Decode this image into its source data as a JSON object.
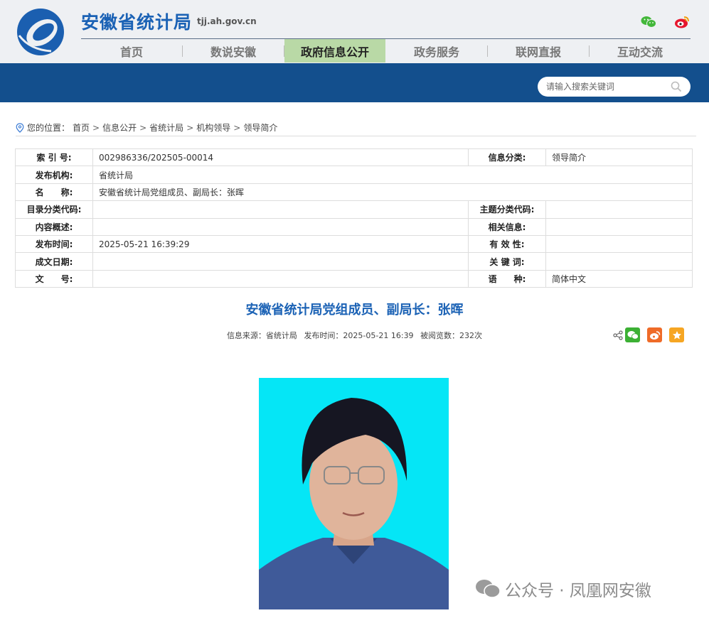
{
  "header": {
    "site_title": "安徽省统计局",
    "site_domain": "tjj.ah.gov.cn",
    "nav": [
      "首页",
      "数说安徽",
      "政府信息公开",
      "政务服务",
      "联网直报",
      "互动交流"
    ],
    "active_nav": "政府信息公开",
    "search_placeholder": "请输入搜索关键词"
  },
  "breadcrumb": {
    "prefix": "您的位置：",
    "items": [
      "首页",
      "信息公开",
      "省统计局",
      "机构领导",
      "领导简介"
    ]
  },
  "meta_table": {
    "index_label": "索 引 号:",
    "index_value": "002986336/202505-00014",
    "category_label": "信息分类:",
    "category_value": "领导简介",
    "publisher_label": "发布机构:",
    "publisher_value": "省统计局",
    "name_label": "名　　称:",
    "name_value": "安徽省统计局党组成员、副局长：张晖",
    "catalog_label": "目录分类代码:",
    "catalog_value": "",
    "topic_label": "主题分类代码:",
    "topic_value": "",
    "summary_label": "内容概述:",
    "summary_value": "",
    "related_label": "相关信息:",
    "related_value": "",
    "pubtime_label": "发布时间:",
    "pubtime_value": "2025-05-21 16:39:29",
    "validity_label": "有 效 性:",
    "validity_value": "",
    "date_label": "成文日期:",
    "date_value": "",
    "keyword_label": "关 键 词:",
    "keyword_value": "",
    "docno_label": "文　　号:",
    "docno_value": "",
    "language_label": "语　　种:",
    "language_value": "简体中文"
  },
  "article": {
    "title": "安徽省统计局党组成员、副局长：张晖",
    "source": "信息来源：省统计局",
    "time": "发布时间：2025-05-21 16:39",
    "views": "被阅览数：232次"
  },
  "watermark": "公众号 · 凤凰网安徽",
  "colors": {
    "brand_blue": "#1b62b5",
    "banner": "#134f8d",
    "active_nav": "#b9d9a6",
    "photo_bg": "#05e6f6"
  }
}
